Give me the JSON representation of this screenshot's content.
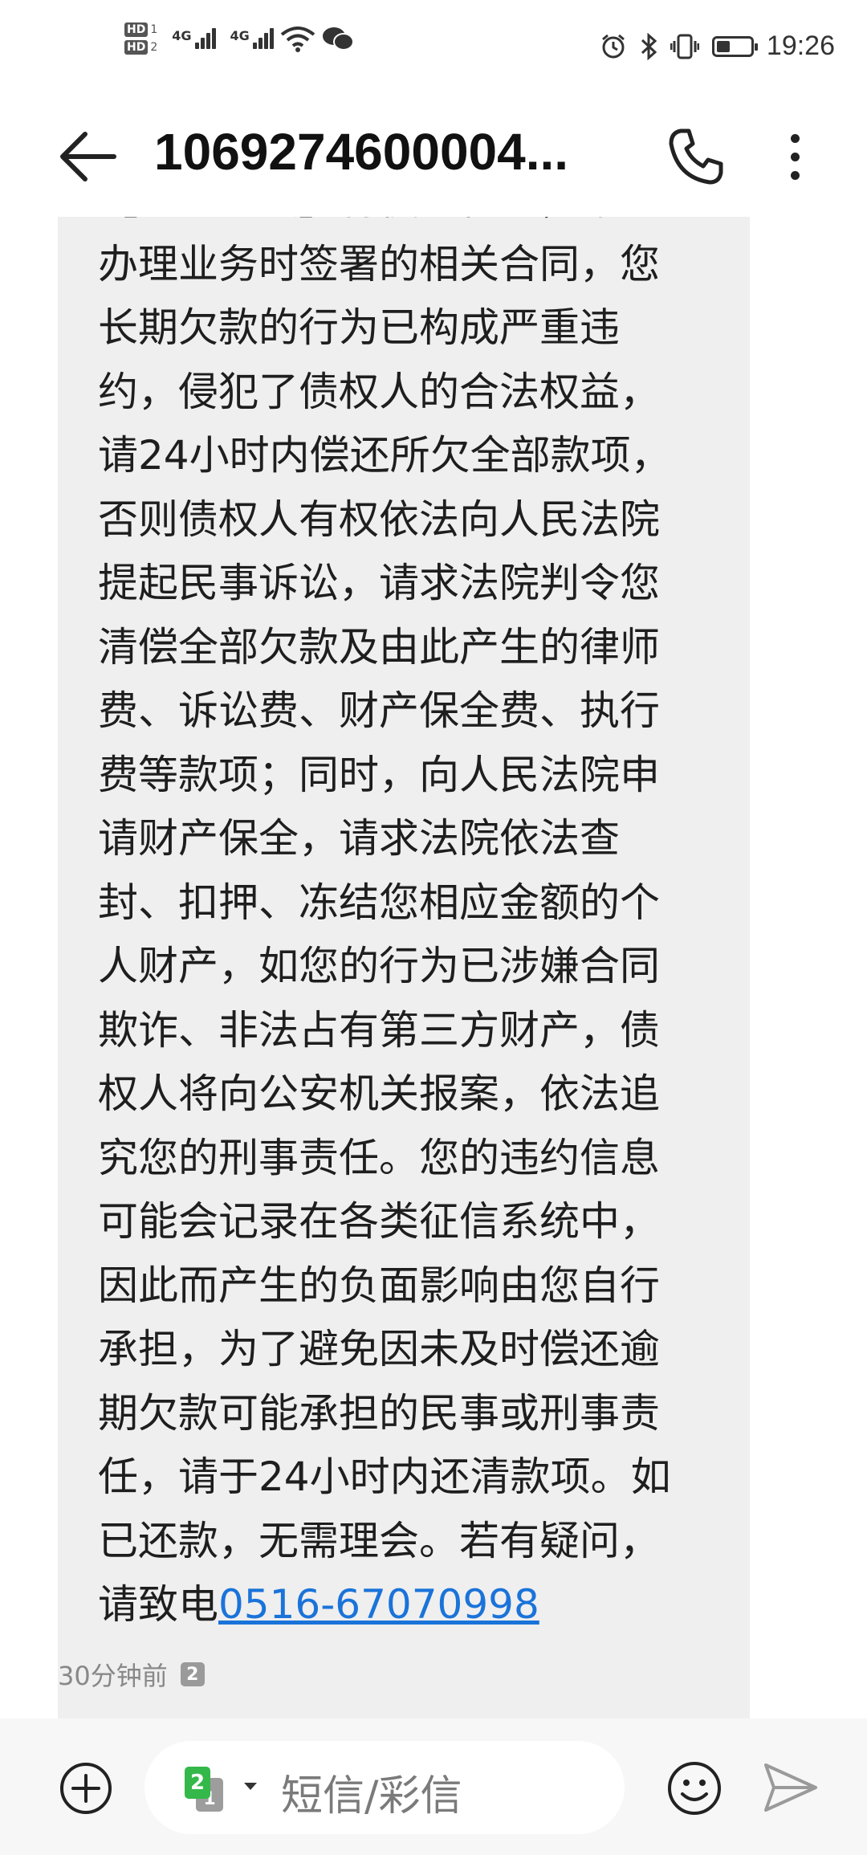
{
  "status_bar": {
    "hd1_label": "HD",
    "hd1_num": "1",
    "hd2_label": "HD",
    "hd2_num": "2",
    "network1": "4G",
    "network2": "4G",
    "time": "19:26",
    "battery_level": 0.4,
    "icons": [
      "alarm-icon",
      "bluetooth-icon",
      "vibrate-icon",
      "battery-icon",
      "wifi-icon",
      "wechat-icon"
    ]
  },
  "header": {
    "title": "1069274600004...",
    "icons": [
      "back-arrow-icon",
      "phone-icon",
      "more-vertical-icon"
    ]
  },
  "message": {
    "lines": [
      "【水奶金融】特使授行为，据您",
      "办理业务时签署的相关合同，您",
      "长期欠款的行为已构成严重违",
      "约，侵犯了债权人的合法权益，",
      "请24小时内偿还所欠全部款项，",
      "否则债权人有权依法向人民法院",
      "提起民事诉讼，请求法院判令您",
      "清偿全部欠款及由此产生的律师",
      "费、诉讼费、财产保全费、执行",
      "费等款项；同时，向人民法院申",
      "请财产保全，请求法院依法查",
      "封、扣押、冻结您相应金额的个",
      "人财产，如您的行为已涉嫌合同",
      "欺诈、非法占有第三方财产，债",
      "权人将向公安机关报案，依法追",
      "究您的刑事责任。您的违约信息",
      "可能会记录在各类征信系统中，",
      "因此而产生的负面影响由您自行",
      "承担，为了避免因未及时偿还逾",
      "期欠款可能承担的民事或刑事责",
      "任，请于24小时内还清款项。如",
      "已还款，无需理会。若有疑问，"
    ],
    "last_line_prefix": "请致电",
    "phone_link": "0516-67070998",
    "timestamp": "30分钟前",
    "sim_badge": "2"
  },
  "composer": {
    "sim_front": "2",
    "sim_back": "1",
    "placeholder": "短信/彩信",
    "icons": [
      "add-icon",
      "sim-select-icon",
      "emoji-icon",
      "send-icon"
    ]
  },
  "colors": {
    "bubble": "#efefef",
    "link": "#1a73d9",
    "sim_green": "#34b84a"
  }
}
